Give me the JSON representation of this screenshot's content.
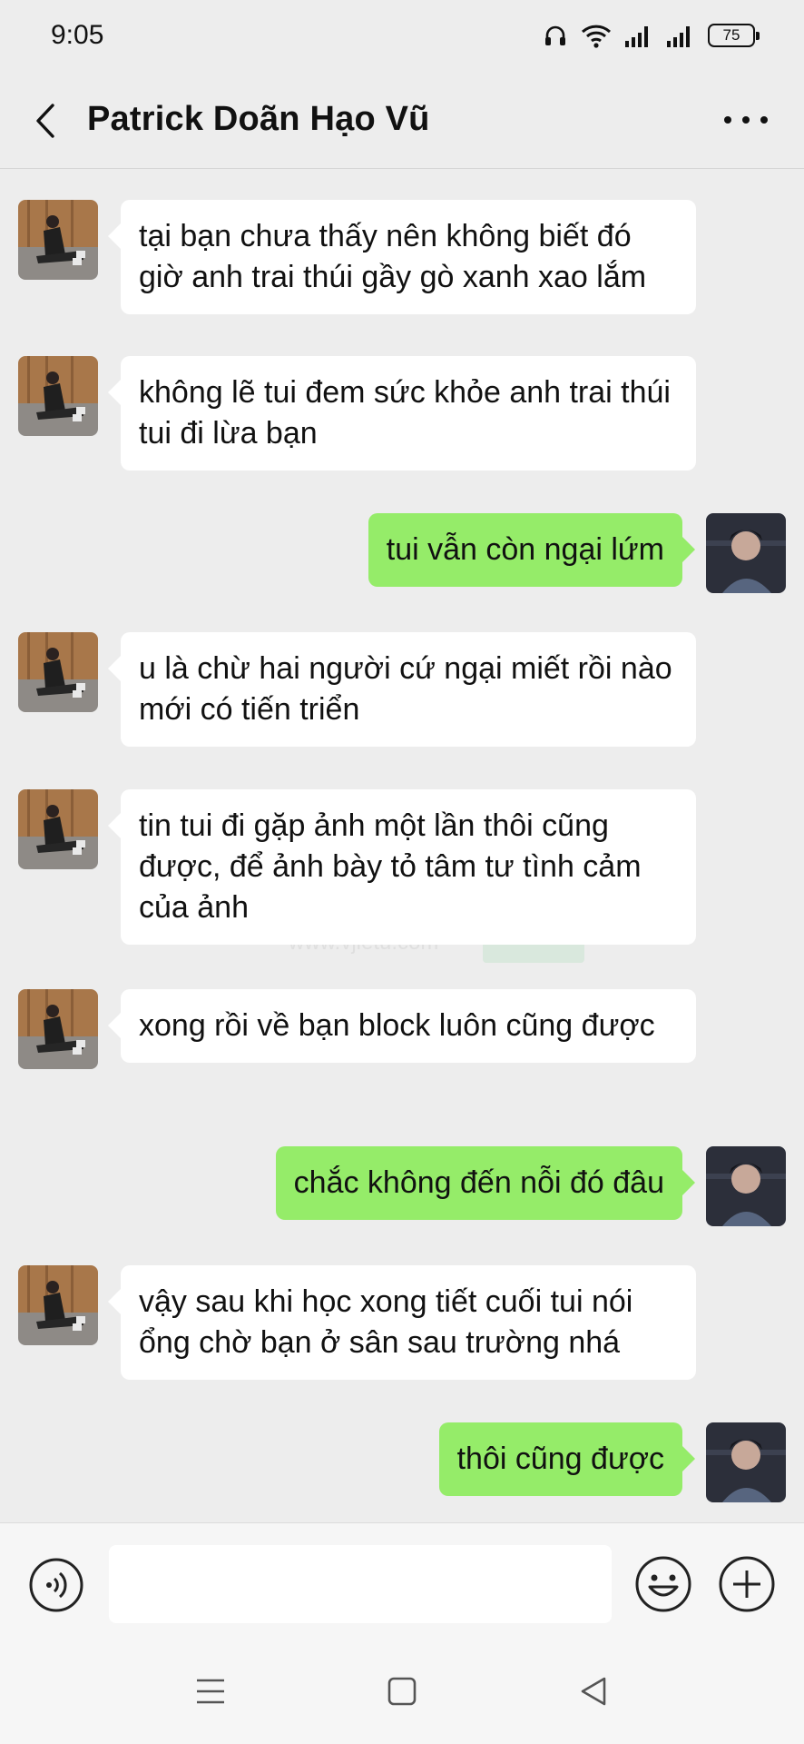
{
  "status_bar": {
    "time": "9:05",
    "battery": "75",
    "icons": [
      "headphones-icon",
      "wifi-icon",
      "signal-icon",
      "signal-icon",
      "battery-icon"
    ]
  },
  "header": {
    "title": "Patrick Doãn Hạo Vũ",
    "back_icon": "chevron-left-icon",
    "more_icon": "more-horizontal-icon"
  },
  "messages": [
    {
      "side": "in",
      "text": "tại bạn chưa thấy nên không biết đó giờ anh trai thúi gầy gò xanh xao lắm"
    },
    {
      "side": "in",
      "text": "không lẽ tui đem sức khỏe anh trai thúi tui đi lừa bạn"
    },
    {
      "side": "out",
      "text": "tui vẫn còn ngại lứm"
    },
    {
      "side": "in",
      "text": "u là chừ hai người cứ ngại miết rồi nào mới có tiến triển"
    },
    {
      "side": "in",
      "text": "tin tui đi gặp ảnh một lần thôi cũng được, để ảnh bày tỏ tâm tư tình cảm của ảnh"
    },
    {
      "side": "in",
      "text": "xong rồi về bạn block luôn cũng được"
    },
    {
      "side": "out",
      "text": "chắc không đến nỗi đó đâu"
    },
    {
      "side": "in",
      "text": "vậy sau khi học xong tiết cuối tui nói ổng chờ bạn ở sân sau trường nhá"
    },
    {
      "side": "out",
      "text": "thôi cũng được"
    }
  ],
  "watermark": {
    "text": "微信图",
    "url": "www.vjietu.com"
  },
  "input_bar": {
    "voice_icon": "voice-icon",
    "placeholder": "",
    "emoji_icon": "emoji-icon",
    "plus_icon": "plus-icon"
  },
  "colors": {
    "background": "#ededed",
    "incoming_bubble": "#ffffff",
    "outgoing_bubble": "#95ec69",
    "text": "#111111"
  }
}
